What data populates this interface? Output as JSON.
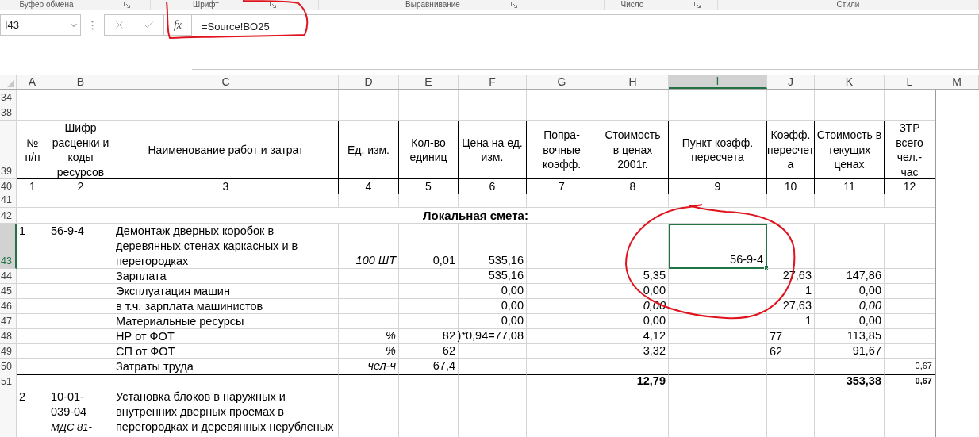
{
  "ribbon_groups": [
    {
      "label": "Буфер обмена",
      "launcher": true
    },
    {
      "label": "Шрифт",
      "launcher": true
    },
    {
      "label": "Выравнивание",
      "launcher": true
    },
    {
      "label": "Число",
      "launcher": true
    },
    {
      "label": "Стили",
      "launcher": false
    }
  ],
  "formula_bar": {
    "name_box": "I43",
    "fx_label": "fx",
    "formula": "=Source!BO25"
  },
  "columns": [
    {
      "letter": "A",
      "selected": false
    },
    {
      "letter": "B",
      "selected": false
    },
    {
      "letter": "C",
      "selected": false
    },
    {
      "letter": "D",
      "selected": false
    },
    {
      "letter": "E",
      "selected": false
    },
    {
      "letter": "F",
      "selected": false
    },
    {
      "letter": "G",
      "selected": false
    },
    {
      "letter": "H",
      "selected": false
    },
    {
      "letter": "I",
      "selected": true
    },
    {
      "letter": "J",
      "selected": false
    },
    {
      "letter": "K",
      "selected": false
    },
    {
      "letter": "L",
      "selected": false
    },
    {
      "letter": "M",
      "selected": false
    }
  ],
  "rows": [
    {
      "number": "34",
      "selected": false,
      "kind": "blank"
    },
    {
      "number": "38",
      "selected": false,
      "kind": "blank"
    },
    {
      "number": "39",
      "selected": false,
      "kind": "header",
      "cells": [
        "№ п/п",
        "Шифр расценки и коды ресурсов",
        "Наименование работ и затрат",
        "Ед. изм.",
        "Кол-во единиц",
        "Цена на ед. изм.",
        "Попра-вочные коэфф.",
        "Стоимость в ценах 2001г.",
        "Пункт коэфф. пересчета",
        "Коэфф. пересчета",
        "Стоимость в текущих ценах",
        "ЗТР всего чел.-час"
      ]
    },
    {
      "number": "40",
      "selected": false,
      "kind": "header",
      "cells": [
        "1",
        "2",
        "3",
        "4",
        "5",
        "6",
        "7",
        "8",
        "9",
        "10",
        "11",
        "12"
      ]
    },
    {
      "number": "41",
      "selected": false,
      "kind": "blank"
    },
    {
      "number": "42",
      "selected": false,
      "kind": "title",
      "title": "Локальная смета:"
    },
    {
      "number": "43",
      "selected": true,
      "kind": "data",
      "cells": [
        {
          "text": "1",
          "kind": "text",
          "selected": false
        },
        {
          "text": "56-9-4",
          "kind": "text",
          "selected": false
        },
        {
          "text": "Демонтаж дверных коробок в деревянных стенах каркасных и в перегородках",
          "kind": "text",
          "selected": false
        },
        {
          "text": "100 ШТ",
          "kind": "number",
          "italic": true,
          "selected": false
        },
        {
          "text": "0,01",
          "kind": "number",
          "selected": false
        },
        {
          "text": "535,16",
          "kind": "number",
          "selected": false
        },
        {
          "kind": "empty",
          "selected": false
        },
        {
          "kind": "empty",
          "selected": false
        },
        {
          "text": "56-9-4",
          "kind": "number",
          "selected": true
        },
        {
          "kind": "empty",
          "selected": false
        },
        {
          "kind": "empty",
          "selected": false
        },
        {
          "kind": "empty",
          "selected": false
        }
      ]
    },
    {
      "number": "44",
      "selected": false,
      "kind": "data",
      "cells": [
        {
          "kind": "empty",
          "selected": false
        },
        {
          "kind": "empty",
          "selected": false
        },
        {
          "text": "Зарплата",
          "kind": "text",
          "selected": false
        },
        {
          "kind": "empty",
          "selected": false
        },
        {
          "kind": "empty",
          "selected": false
        },
        {
          "text": "535,16",
          "kind": "number",
          "selected": false
        },
        {
          "kind": "empty",
          "selected": false
        },
        {
          "text": "5,35",
          "kind": "number",
          "selected": false
        },
        {
          "kind": "empty",
          "selected": false
        },
        {
          "text": "27,63",
          "kind": "number",
          "selected": false
        },
        {
          "text": "147,86",
          "kind": "number",
          "selected": false
        },
        {
          "kind": "empty",
          "selected": false
        }
      ]
    },
    {
      "number": "45",
      "selected": false,
      "kind": "data",
      "cells": [
        {
          "kind": "empty",
          "selected": false
        },
        {
          "kind": "empty",
          "selected": false
        },
        {
          "text": "Эксплуатация машин",
          "kind": "text",
          "selected": false
        },
        {
          "kind": "empty",
          "selected": false
        },
        {
          "kind": "empty",
          "selected": false
        },
        {
          "text": "0,00",
          "kind": "number",
          "selected": false
        },
        {
          "kind": "empty",
          "selected": false
        },
        {
          "text": "0,00",
          "kind": "number",
          "selected": false
        },
        {
          "kind": "empty",
          "selected": false
        },
        {
          "text": "1",
          "kind": "number",
          "selected": false
        },
        {
          "text": "0,00",
          "kind": "number",
          "selected": false
        },
        {
          "kind": "empty",
          "selected": false
        }
      ]
    },
    {
      "number": "46",
      "selected": false,
      "kind": "data",
      "cells": [
        {
          "kind": "empty",
          "selected": false
        },
        {
          "kind": "empty",
          "selected": false
        },
        {
          "text": "в т.ч. зарплата машинистов",
          "kind": "text",
          "selected": false
        },
        {
          "kind": "empty",
          "selected": false
        },
        {
          "kind": "empty",
          "selected": false
        },
        {
          "text": "0,00",
          "kind": "number",
          "selected": false
        },
        {
          "kind": "empty",
          "selected": false
        },
        {
          "text": "0,00",
          "kind": "number",
          "italic": true,
          "selected": false
        },
        {
          "kind": "empty",
          "selected": false
        },
        {
          "text": "27,63",
          "kind": "number",
          "selected": false
        },
        {
          "text": "0,00",
          "kind": "number",
          "italic": true,
          "selected": false
        },
        {
          "kind": "empty",
          "selected": false
        }
      ]
    },
    {
      "number": "47",
      "selected": false,
      "kind": "data",
      "cells": [
        {
          "kind": "empty",
          "selected": false
        },
        {
          "kind": "empty",
          "selected": false
        },
        {
          "text": "Материальные ресурсы",
          "kind": "text",
          "selected": false
        },
        {
          "kind": "empty",
          "selected": false
        },
        {
          "kind": "empty",
          "selected": false
        },
        {
          "text": "0,00",
          "kind": "number",
          "selected": false
        },
        {
          "kind": "empty",
          "selected": false
        },
        {
          "text": "0,00",
          "kind": "number",
          "selected": false
        },
        {
          "kind": "empty",
          "selected": false
        },
        {
          "text": "1",
          "kind": "number",
          "selected": false
        },
        {
          "text": "0,00",
          "kind": "number",
          "selected": false
        },
        {
          "kind": "empty",
          "selected": false
        }
      ]
    },
    {
      "number": "48",
      "selected": false,
      "kind": "data",
      "cells": [
        {
          "kind": "empty",
          "selected": false
        },
        {
          "kind": "empty",
          "selected": false
        },
        {
          "text": "НР от ФОТ",
          "kind": "text",
          "selected": false
        },
        {
          "text": "%",
          "kind": "number",
          "italic": true,
          "selected": false
        },
        {
          "text": "82",
          "kind": "number",
          "selected": false
        },
        {
          "text": ")*0,94=77,08",
          "kind": "number",
          "selected": false
        },
        {
          "kind": "empty",
          "selected": false
        },
        {
          "text": "4,12",
          "kind": "number",
          "selected": false
        },
        {
          "kind": "empty",
          "selected": false
        },
        {
          "text": "77",
          "kind": "text",
          "selected": false
        },
        {
          "text": "113,85",
          "kind": "number",
          "selected": false
        },
        {
          "kind": "empty",
          "selected": false
        }
      ]
    },
    {
      "number": "49",
      "selected": false,
      "kind": "data",
      "cells": [
        {
          "kind": "empty",
          "selected": false
        },
        {
          "kind": "empty",
          "selected": false
        },
        {
          "text": "СП от ФОТ",
          "kind": "text",
          "selected": false
        },
        {
          "text": "%",
          "kind": "number",
          "italic": true,
          "selected": false
        },
        {
          "text": "62",
          "kind": "number",
          "selected": false
        },
        {
          "kind": "empty",
          "selected": false
        },
        {
          "kind": "empty",
          "selected": false
        },
        {
          "text": "3,32",
          "kind": "number",
          "selected": false
        },
        {
          "kind": "empty",
          "selected": false
        },
        {
          "text": "62",
          "kind": "text",
          "selected": false
        },
        {
          "text": "91,67",
          "kind": "number",
          "selected": false
        },
        {
          "kind": "empty",
          "selected": false
        }
      ]
    },
    {
      "number": "50",
      "selected": false,
      "kind": "data",
      "cells": [
        {
          "kind": "empty",
          "selected": false
        },
        {
          "kind": "empty",
          "selected": false
        },
        {
          "text": "Затраты труда",
          "kind": "text",
          "selected": false
        },
        {
          "text": "чел-ч",
          "kind": "number",
          "italic": true,
          "selected": false
        },
        {
          "text": "67,4",
          "kind": "number",
          "selected": false
        },
        {
          "kind": "empty",
          "selected": false
        },
        {
          "kind": "empty",
          "selected": false
        },
        {
          "kind": "empty",
          "selected": false
        },
        {
          "kind": "empty",
          "selected": false
        },
        {
          "kind": "empty",
          "selected": false
        },
        {
          "kind": "empty",
          "selected": false
        },
        {
          "text": "0,67",
          "kind": "small-number",
          "selected": false
        }
      ]
    },
    {
      "number": "51",
      "selected": false,
      "kind": "total",
      "cells": [
        {
          "kind": "empty",
          "selected": false
        },
        {
          "kind": "empty",
          "selected": false
        },
        {
          "kind": "empty",
          "selected": false
        },
        {
          "kind": "empty",
          "selected": false
        },
        {
          "kind": "empty",
          "selected": false
        },
        {
          "kind": "empty",
          "selected": false
        },
        {
          "kind": "empty",
          "selected": false
        },
        {
          "text": "12,79",
          "kind": "number",
          "bold": true,
          "selected": false
        },
        {
          "kind": "empty",
          "selected": false
        },
        {
          "kind": "empty",
          "selected": false
        },
        {
          "text": "353,38",
          "kind": "number",
          "bold": true,
          "selected": false
        },
        {
          "text": "0,67",
          "kind": "small-number",
          "bold": true,
          "selected": false
        }
      ]
    },
    {
      "selected": false,
      "kind": "data",
      "cells": [
        {
          "text": "2",
          "kind": "text",
          "selected": false
        },
        {
          "text": "10-01-039-04",
          "note": "МДС 81-",
          "kind": "text",
          "selected": false
        },
        {
          "text": "Установка блоков в наружных и внутренних дверных проемах в перегородках и деревянных нерубленых",
          "kind": "text",
          "selected": false
        },
        {
          "kind": "empty",
          "selected": false
        },
        {
          "kind": "empty",
          "selected": false
        },
        {
          "kind": "empty",
          "selected": false
        },
        {
          "kind": "empty",
          "selected": false
        },
        {
          "kind": "empty",
          "selected": false
        },
        {
          "kind": "empty",
          "selected": false
        },
        {
          "kind": "empty",
          "selected": false
        },
        {
          "kind": "empty",
          "selected": false
        },
        {
          "kind": "empty",
          "selected": false
        }
      ]
    }
  ]
}
